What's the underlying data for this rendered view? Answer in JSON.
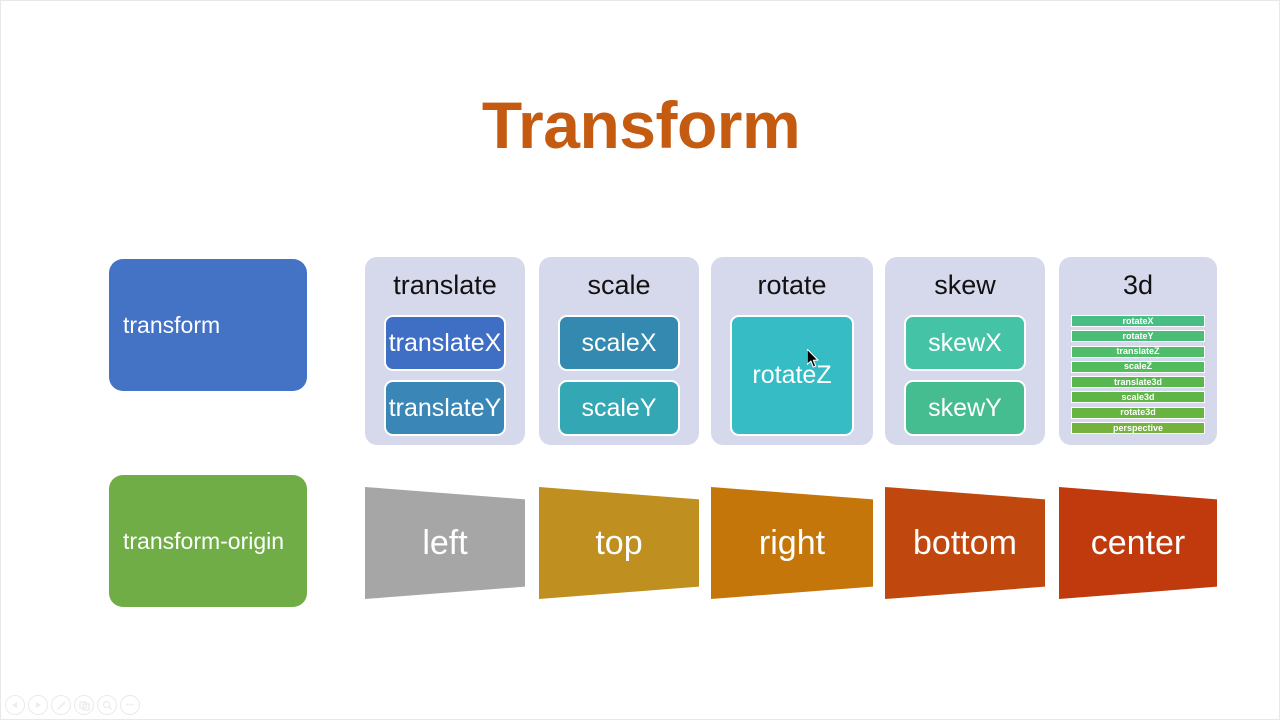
{
  "slide": {
    "title": "Transform",
    "title_color": "#c55a11",
    "background": "#ffffff"
  },
  "rows": {
    "transform": {
      "label": "transform",
      "color": "#4472c4"
    },
    "transform_origin": {
      "label": "transform-origin",
      "color": "#70ad47"
    }
  },
  "groups": [
    {
      "title": "translate",
      "container_color": "#d6d8ec",
      "chips": [
        {
          "label": "translateX",
          "color": "#3f6fc4"
        },
        {
          "label": "translateY",
          "color": "#3a87b7"
        }
      ]
    },
    {
      "title": "scale",
      "container_color": "#d6d8ec",
      "chips": [
        {
          "label": "scaleX",
          "color": "#3389b0"
        },
        {
          "label": "scaleY",
          "color": "#34a7b5"
        }
      ]
    },
    {
      "title": "rotate",
      "container_color": "#d6d8ec",
      "chips": [
        {
          "label": "rotateZ",
          "color": "#36bcc4"
        }
      ]
    },
    {
      "title": "skew",
      "container_color": "#d6d8ec",
      "chips": [
        {
          "label": "skewX",
          "color": "#44c3a6"
        },
        {
          "label": "skewY",
          "color": "#45bd90"
        }
      ]
    },
    {
      "title": "3d",
      "container_color": "#d6d8ec",
      "bars": [
        {
          "label": "rotateX",
          "color": "#48bd84"
        },
        {
          "label": "rotateY",
          "color": "#4cbd77"
        },
        {
          "label": "translateZ",
          "color": "#4fbd6a"
        },
        {
          "label": "scaleZ",
          "color": "#53bd5d"
        },
        {
          "label": "translate3d",
          "color": "#58b84f"
        },
        {
          "label": "scale3d",
          "color": "#5fb646"
        },
        {
          "label": "rotate3d",
          "color": "#67b441"
        },
        {
          "label": "perspective",
          "color": "#74b13d"
        }
      ]
    }
  ],
  "origins": [
    {
      "label": "left",
      "color": "#a6a6a6"
    },
    {
      "label": "top",
      "color": "#bf8f20"
    },
    {
      "label": "right",
      "color": "#c5760a"
    },
    {
      "label": "bottom",
      "color": "#c0480e"
    },
    {
      "label": "center",
      "color": "#c03a0d"
    }
  ],
  "toolbar": {
    "buttons": [
      {
        "name": "previous-slide",
        "icon": "triangle-left-icon"
      },
      {
        "name": "next-slide",
        "icon": "triangle-right-icon"
      },
      {
        "name": "pen-tool",
        "icon": "pen-icon"
      },
      {
        "name": "slide-overview",
        "icon": "grid-icon"
      },
      {
        "name": "zoom-tool",
        "icon": "magnifier-icon"
      },
      {
        "name": "more-options",
        "icon": "ellipsis-icon",
        "label": "•••"
      }
    ]
  }
}
